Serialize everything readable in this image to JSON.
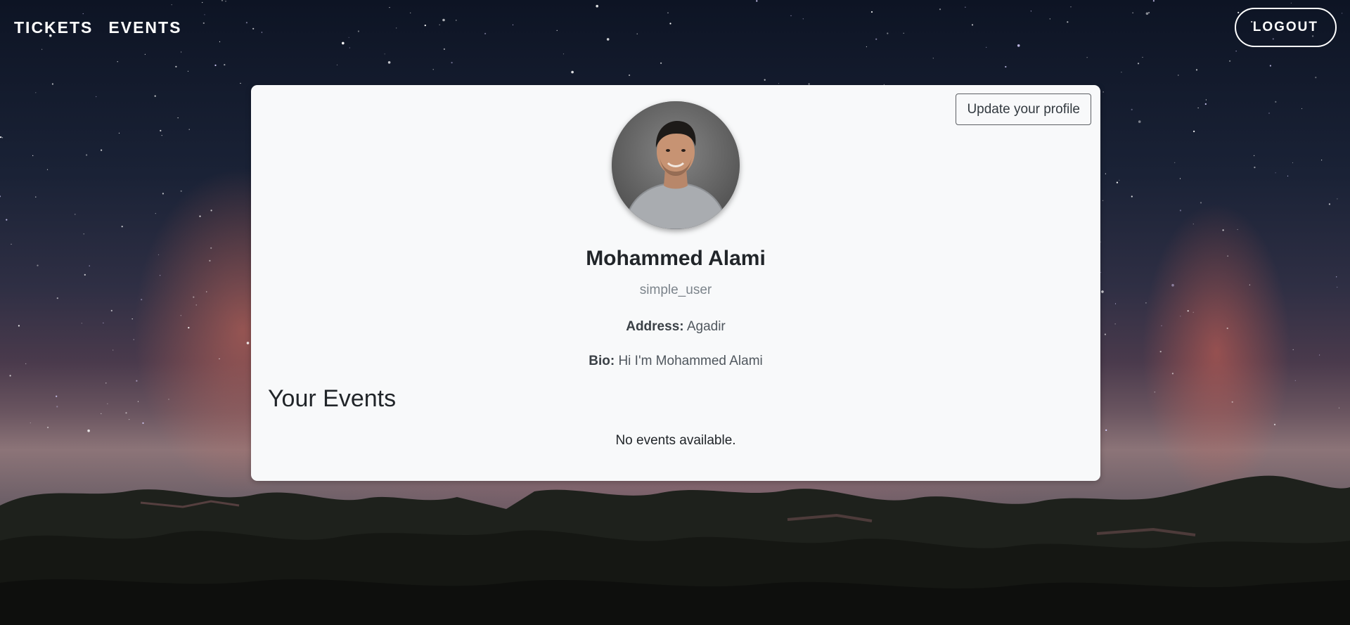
{
  "nav": {
    "links": [
      {
        "label": "TICKETS"
      },
      {
        "label": "EVENTS"
      }
    ],
    "logout_label": "LOGOUT"
  },
  "profile": {
    "update_label": "Update your profile",
    "name": "Mohammed Alami",
    "role": "simple_user",
    "address_label": "Address:",
    "address": "Agadir",
    "bio_label": "Bio:",
    "bio": "Hi I'm Mohammed Alami"
  },
  "events": {
    "title": "Your Events",
    "empty_message": "No events available."
  }
}
